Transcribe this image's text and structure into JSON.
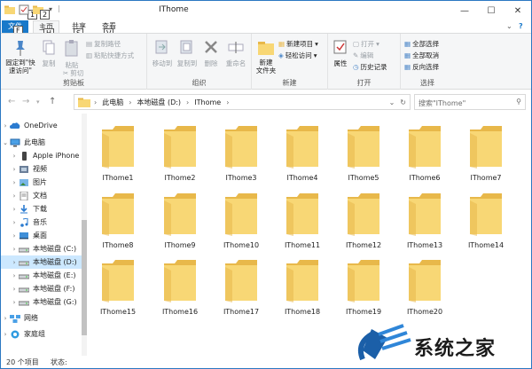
{
  "window": {
    "title": "IThome"
  },
  "keytips": {
    "qa1": "1",
    "qa2": "2",
    "file": "F",
    "home": "H",
    "share": "S",
    "view": "V"
  },
  "tabs": {
    "file": "文件",
    "home": "主页",
    "share": "共享",
    "view": "查看"
  },
  "ribbon": {
    "clipboard": {
      "label": "剪贴板",
      "pin": "固定到\"快速访问\"",
      "copy": "复制",
      "paste": "粘贴",
      "copy_path": "复制路径",
      "paste_shortcut": "粘贴快捷方式",
      "cut": "剪切"
    },
    "organize": {
      "label": "组织",
      "move_to": "移动到",
      "copy_to": "复制到",
      "delete": "删除",
      "rename": "重命名"
    },
    "new": {
      "label": "新建",
      "new_folder": "新建\n文件夹",
      "new_item": "新建项目",
      "easy_access": "轻松访问"
    },
    "open": {
      "label": "打开",
      "properties": "属性",
      "open": "打开",
      "edit": "编辑",
      "history": "历史记录"
    },
    "select": {
      "label": "选择",
      "select_all": "全部选择",
      "select_none": "全部取消",
      "invert": "反向选择"
    }
  },
  "address": {
    "path": [
      "此电脑",
      "本地磁盘 (D:)",
      "IThome"
    ],
    "search_placeholder": "搜索\"IThome\""
  },
  "nav": {
    "items": [
      {
        "label": "OneDrive",
        "icon": "cloud-icon"
      },
      {
        "label": "此电脑",
        "icon": "computer-icon"
      },
      {
        "label": "Apple iPhone",
        "icon": "phone-icon"
      },
      {
        "label": "视频",
        "icon": "video-icon"
      },
      {
        "label": "图片",
        "icon": "picture-icon"
      },
      {
        "label": "文档",
        "icon": "document-icon"
      },
      {
        "label": "下载",
        "icon": "download-icon"
      },
      {
        "label": "音乐",
        "icon": "music-icon"
      },
      {
        "label": "桌面",
        "icon": "desktop-icon"
      },
      {
        "label": "本地磁盘 (C:)",
        "icon": "drive-icon"
      },
      {
        "label": "本地磁盘 (D:)",
        "icon": "drive-icon"
      },
      {
        "label": "本地磁盘 (E:)",
        "icon": "drive-icon"
      },
      {
        "label": "本地磁盘 (F:)",
        "icon": "drive-icon"
      },
      {
        "label": "本地磁盘 (G:)",
        "icon": "drive-icon"
      },
      {
        "label": "网络",
        "icon": "network-icon"
      },
      {
        "label": "家庭组",
        "icon": "homegroup-icon"
      }
    ]
  },
  "folders": [
    "IThome1",
    "IThome2",
    "IThome3",
    "IThome4",
    "IThome5",
    "IThome6",
    "IThome7",
    "IThome8",
    "IThome9",
    "IThome10",
    "IThome11",
    "IThome12",
    "IThome13",
    "IThome14",
    "IThome15",
    "IThome16",
    "IThome17",
    "IThome18",
    "IThome19",
    "IThome20"
  ],
  "status": {
    "count": "20 个项目",
    "state": "状态:"
  },
  "watermark": {
    "text": "系统之家"
  },
  "colors": {
    "accent": "#1979ca",
    "folder": "#f8d775",
    "folder_dark": "#e8b84a",
    "selected": "#cce8ff"
  }
}
